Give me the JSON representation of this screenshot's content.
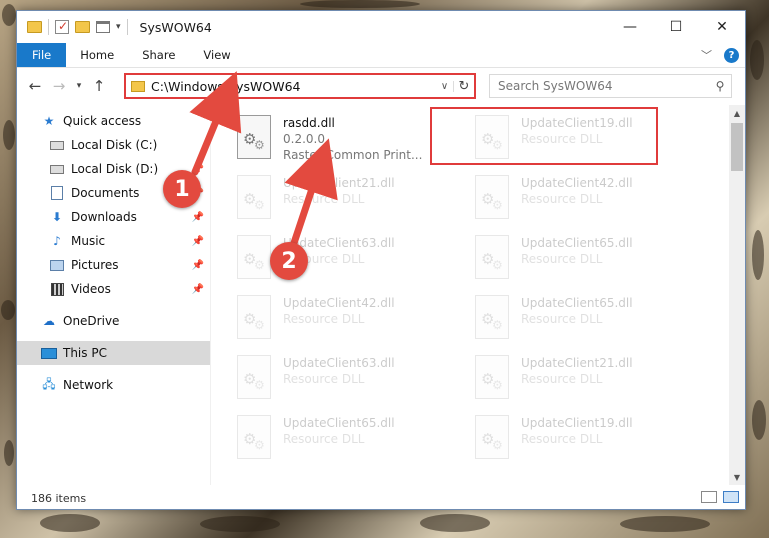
{
  "window": {
    "title": "SysWOW64"
  },
  "titlebar": {
    "min_glyph": "—",
    "max_glyph": "☐",
    "close_glyph": "✕"
  },
  "ribbon": {
    "tabs": [
      "File",
      "Home",
      "Share",
      "View"
    ],
    "help_glyph": "?"
  },
  "nav": {
    "address": "C:\\Windows\\SysWOW64",
    "search_placeholder": "Search SysWOW64"
  },
  "sidebar": {
    "items": [
      {
        "label": "Quick access",
        "icon": "star-icon"
      },
      {
        "label": "Local Disk (C:)",
        "icon": "drive-icon"
      },
      {
        "label": "Local Disk (D:)",
        "icon": "drive-icon"
      },
      {
        "label": "Documents",
        "icon": "documents-icon"
      },
      {
        "label": "Downloads",
        "icon": "downloads-icon"
      },
      {
        "label": "Music",
        "icon": "music-icon"
      },
      {
        "label": "Pictures",
        "icon": "pictures-icon"
      },
      {
        "label": "Videos",
        "icon": "videos-icon"
      },
      {
        "label": "OneDrive",
        "icon": "onedrive-icon"
      },
      {
        "label": "This PC",
        "icon": "pc-icon"
      },
      {
        "label": "Network",
        "icon": "network-icon"
      }
    ]
  },
  "files": [
    {
      "name": "rasdd.dll",
      "line2": "0.2.0.0",
      "line3": "Raster Common Print..."
    },
    {
      "name": "UpdateClient19.dll",
      "line2": "Resource DLL"
    },
    {
      "name": "UpdateClient21.dll",
      "line2": "Resource DLL"
    },
    {
      "name": "UpdateClient42.dll",
      "line2": "Resource DLL"
    },
    {
      "name": "UpdateClient63.dll",
      "line2": "Resource DLL"
    },
    {
      "name": "UpdateClient65.dll",
      "line2": "Resource DLL"
    },
    {
      "name": "UpdateClient42.dll",
      "line2": "Resource DLL"
    },
    {
      "name": "UpdateClient65.dll",
      "line2": "Resource DLL"
    },
    {
      "name": "UpdateClient63.dll",
      "line2": "Resource DLL"
    },
    {
      "name": "UpdateClient21.dll",
      "line2": "Resource DLL"
    },
    {
      "name": "UpdateClient65.dll",
      "line2": "Resource DLL"
    },
    {
      "name": "UpdateClient19.dll",
      "line2": "Resource DLL"
    }
  ],
  "status": {
    "count": "186 items"
  },
  "annotations": {
    "step1": "1",
    "step2": "2",
    "color": "#e34a3f"
  }
}
